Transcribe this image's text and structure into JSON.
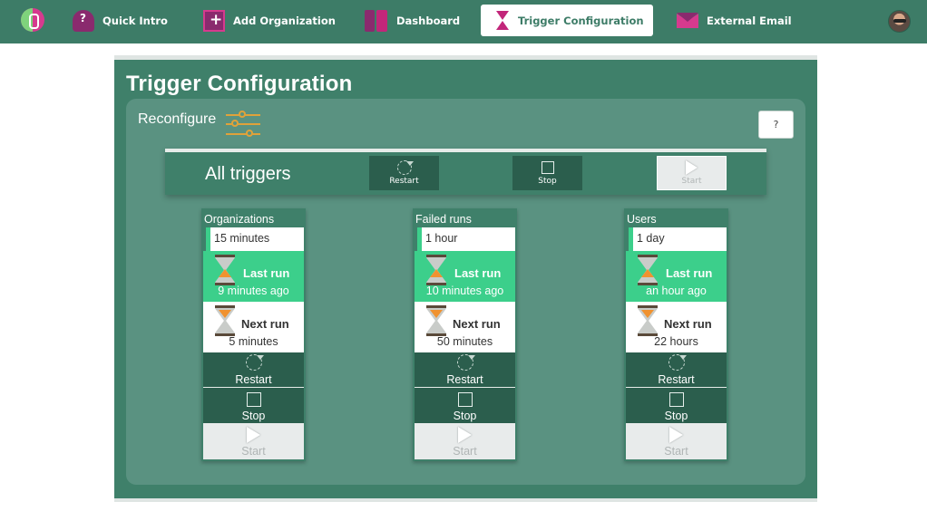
{
  "nav": {
    "items": [
      {
        "label": "Quick Intro",
        "icon": "lightbulb-question-icon"
      },
      {
        "label": "Add Organization",
        "icon": "add-box-icon"
      },
      {
        "label": "Dashboard",
        "icon": "dashboard-icon"
      },
      {
        "label": "Trigger Configuration",
        "icon": "hourglass-icon",
        "active": true
      },
      {
        "label": "External Email",
        "icon": "envelope-icon"
      }
    ]
  },
  "page": {
    "title": "Trigger Configuration",
    "reconfigure_label": "Reconfigure",
    "help_label": "?"
  },
  "all_triggers": {
    "title": "All triggers",
    "restart_label": "Restart",
    "stop_label": "Stop",
    "start_label": "Start"
  },
  "triggers": [
    {
      "name": "Organizations",
      "interval": "15 minutes",
      "last_run_label": "Last run",
      "last_run_value": "9 minutes ago",
      "next_run_label": "Next run",
      "next_run_value": "5 minutes",
      "restart_label": "Restart",
      "stop_label": "Stop",
      "start_label": "Start"
    },
    {
      "name": "Failed runs",
      "interval": "1 hour",
      "last_run_label": "Last run",
      "last_run_value": "10 minutes ago",
      "next_run_label": "Next run",
      "next_run_value": "50 minutes",
      "restart_label": "Restart",
      "stop_label": "Stop",
      "start_label": "Start"
    },
    {
      "name": "Users",
      "interval": "1 day",
      "last_run_label": "Last run",
      "last_run_value": "an hour ago",
      "next_run_label": "Next run",
      "next_run_value": "22 hours",
      "restart_label": "Restart",
      "stop_label": "Stop",
      "start_label": "Start"
    }
  ],
  "colors": {
    "brand_green": "#3d7c67",
    "accent_green": "#3ccf8b",
    "dark_button": "#2b5e4d",
    "accent_magenta": "#c2267a",
    "slider_orange": "#e0a23a"
  }
}
